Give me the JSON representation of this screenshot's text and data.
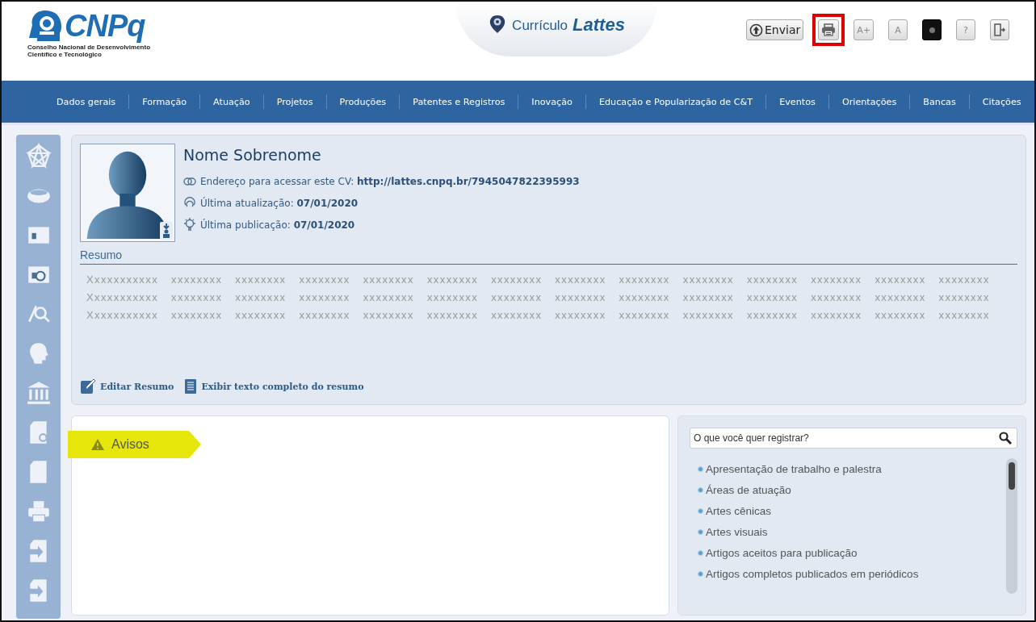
{
  "header": {
    "logo": {
      "name": "CNPq",
      "subtitle_lines": [
        "Conselho Nacional de Desenvolvimento",
        "Científico e Tecnológico"
      ]
    },
    "app_title": {
      "prefix": "Currículo",
      "name": "Lattes"
    },
    "toolbar": [
      {
        "kind": "send",
        "label": "Enviar",
        "highlighted": false
      },
      {
        "kind": "print",
        "highlighted": true
      },
      {
        "kind": "text",
        "label": "A+",
        "highlighted": false
      },
      {
        "kind": "text",
        "label": "A",
        "highlighted": false
      },
      {
        "kind": "contrast",
        "highlighted": false
      },
      {
        "kind": "text",
        "label": "?",
        "highlighted": false
      },
      {
        "kind": "exit",
        "highlighted": false
      }
    ]
  },
  "nav": [
    "Dados gerais",
    "Formação",
    "Atuação",
    "Projetos",
    "Produções",
    "Patentes e Registros",
    "Inovação",
    "Educação e Popularização de C&T",
    "Eventos",
    "Orientações",
    "Bancas",
    "Citações"
  ],
  "profile": {
    "name": "Nome Sobrenome",
    "fields": [
      {
        "kind": "link",
        "label": "Endereço para acessar este CV:",
        "value": "http://lattes.cnpq.br/7945047822395993"
      },
      {
        "kind": "update",
        "label": "Última atualização:",
        "value": "07/01/2020"
      },
      {
        "kind": "publish",
        "label": "Última publicação:",
        "value": "07/01/2020"
      }
    ],
    "summary": {
      "title": "Resumo",
      "lines": [
        "Xxxxxxxxxxx xxxxxxxx xxxxxxxx xxxxxxxx xxxxxxxx xxxxxxxx xxxxxxxx xxxxxxxx xxxxxxxx xxxxxxxx xxxxxxxx xxxxxxxx xxxxxxxx xxxxxxxx",
        "Xxxxxxxxxxx xxxxxxxx xxxxxxxx xxxxxxxx xxxxxxxx xxxxxxxx xxxxxxxx xxxxxxxx xxxxxxxx xxxxxxxx xxxxxxxx xxxxxxxx xxxxxxxx xxxxxxxx",
        "Xxxxxxxxxxx xxxxxxxx xxxxxxxx xxxxxxxx xxxxxxxx xxxxxxxx xxxxxxxx xxxxxxxx xxxxxxxx xxxxxxxx xxxxxxxx xxxxxxxx xxxxxxxx xxxxxxxx"
      ],
      "actions": [
        {
          "kind": "edit",
          "label": "Editar Resumo"
        },
        {
          "kind": "full",
          "label": "Exibir texto completo do resumo"
        }
      ]
    }
  },
  "notices": {
    "title": "Avisos"
  },
  "register": {
    "placeholder": "O que você quer registrar?",
    "items": [
      "Apresentação de trabalho e palestra",
      "Áreas de atuação",
      "Artes cênicas",
      "Artes visuais",
      "Artigos aceitos para publicação",
      "Artigos completos publicados em periódicos"
    ]
  }
}
